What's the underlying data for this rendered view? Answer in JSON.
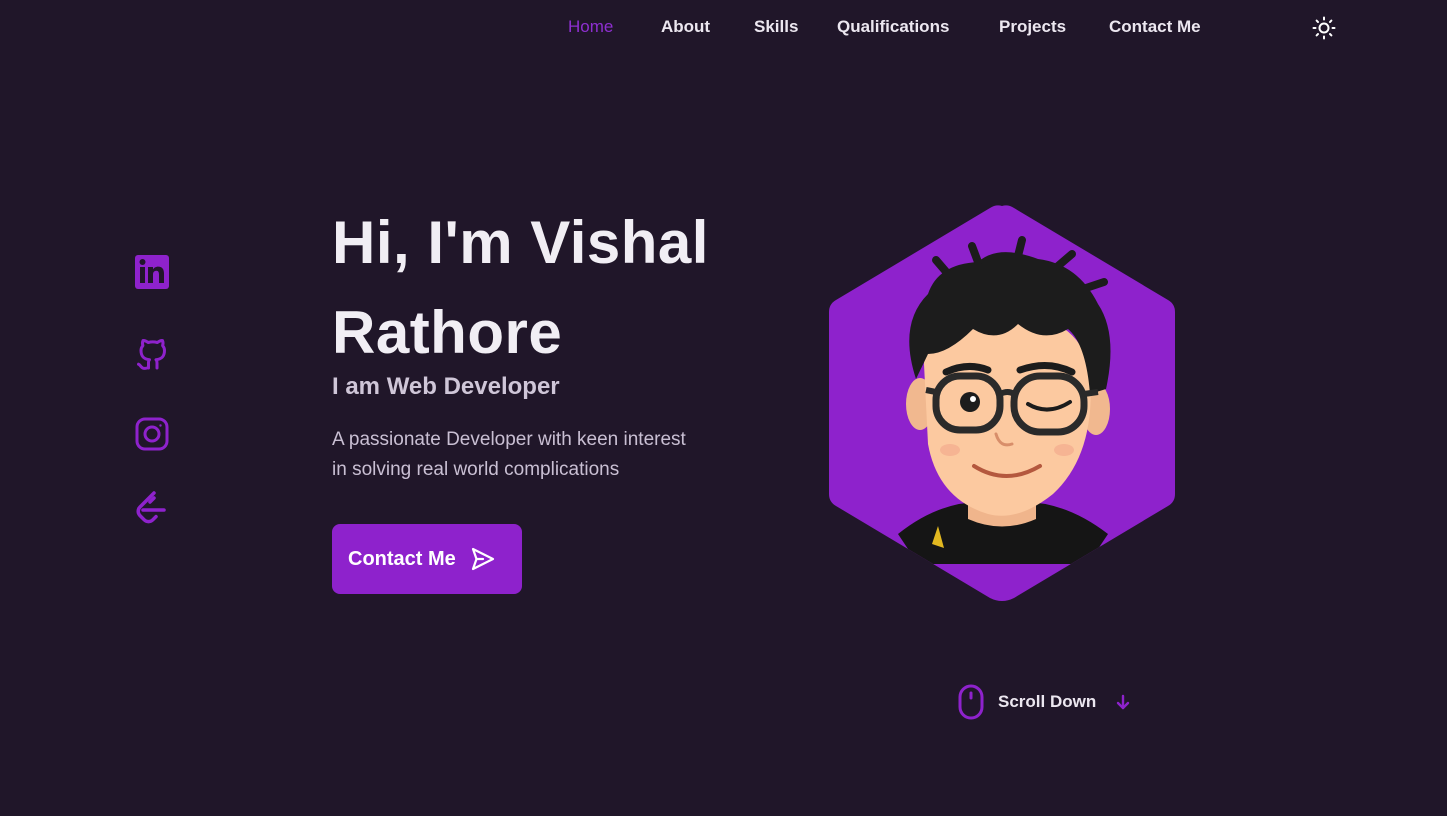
{
  "nav": {
    "links": [
      {
        "label": "Home",
        "active": true
      },
      {
        "label": "About"
      },
      {
        "label": "Skills"
      },
      {
        "label": "Qualifications"
      },
      {
        "label": "Projects"
      },
      {
        "label": "Contact Me"
      }
    ],
    "theme_icon": "sun-icon"
  },
  "social": {
    "icons": [
      "linkedin-icon",
      "github-icon",
      "instagram-icon",
      "leetcode-icon"
    ]
  },
  "hero": {
    "title_line1": "Hi, I'm Vishal",
    "title_line2": "Rathore",
    "subtitle": "I am Web Developer",
    "description_line1": "A passionate Developer with keen interest",
    "description_line2": "in solving real world complications",
    "cta_label": "Contact Me",
    "cta_icon": "send-icon"
  },
  "avatar": {
    "icon": "cartoon-avatar"
  },
  "scroll": {
    "label": "Scroll Down",
    "icons": [
      "mouse-icon",
      "arrow-down-icon"
    ]
  },
  "colors": {
    "background": "#201629",
    "accent": "#8e22cc",
    "text": "#efeaf3"
  }
}
